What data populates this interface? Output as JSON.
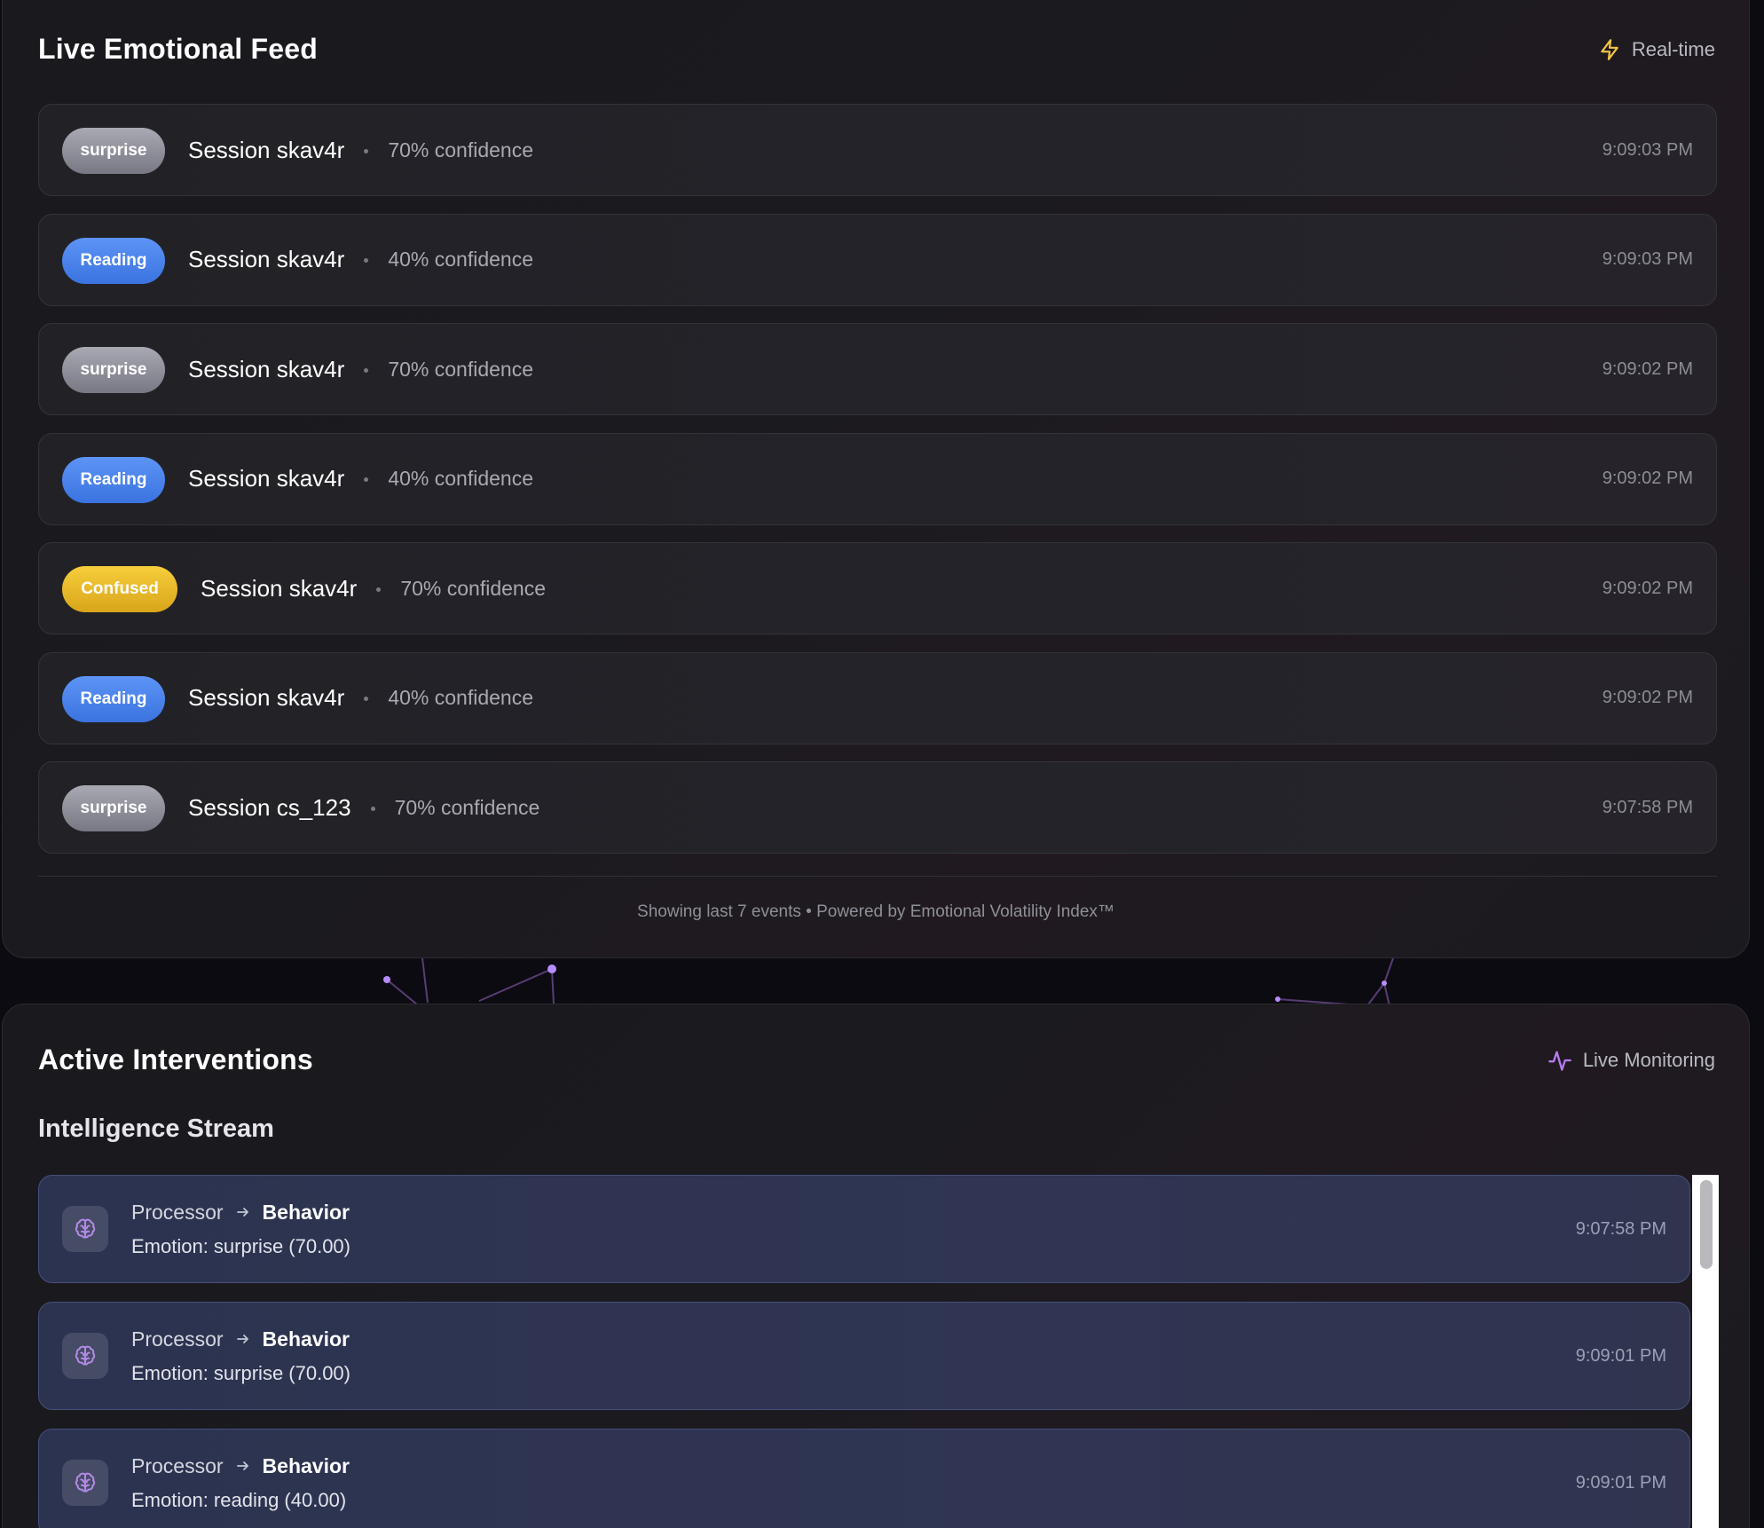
{
  "feed": {
    "title": "Live Emotional Feed",
    "badge_label": "Real-time",
    "badge_icon": "lightning-icon",
    "events": [
      {
        "emotion": "surprise",
        "variant": "surprise",
        "session": "Session skav4r",
        "confidence": "70% confidence",
        "time": "9:09:03 PM"
      },
      {
        "emotion": "Reading",
        "variant": "reading",
        "session": "Session skav4r",
        "confidence": "40% confidence",
        "time": "9:09:03 PM"
      },
      {
        "emotion": "surprise",
        "variant": "surprise",
        "session": "Session skav4r",
        "confidence": "70% confidence",
        "time": "9:09:02 PM"
      },
      {
        "emotion": "Reading",
        "variant": "reading",
        "session": "Session skav4r",
        "confidence": "40% confidence",
        "time": "9:09:02 PM"
      },
      {
        "emotion": "Confused",
        "variant": "confused",
        "session": "Session skav4r",
        "confidence": "70% confidence",
        "time": "9:09:02 PM"
      },
      {
        "emotion": "Reading",
        "variant": "reading",
        "session": "Session skav4r",
        "confidence": "40% confidence",
        "time": "9:09:02 PM"
      },
      {
        "emotion": "surprise",
        "variant": "surprise",
        "session": "Session cs_123",
        "confidence": "70% confidence",
        "time": "9:07:58 PM"
      }
    ],
    "footer": "Showing last 7 events • Powered by Emotional Volatility Index™"
  },
  "interventions": {
    "title": "Active Interventions",
    "badge_label": "Live Monitoring",
    "badge_icon": "activity-pulse-icon",
    "stream_title": "Intelligence Stream",
    "items": [
      {
        "icon": "brain-icon",
        "source": "Processor",
        "target": "Behavior",
        "description": "Emotion: surprise (70.00)",
        "time": "9:07:58 PM"
      },
      {
        "icon": "brain-icon",
        "source": "Processor",
        "target": "Behavior",
        "description": "Emotion: surprise (70.00)",
        "time": "9:09:01 PM"
      },
      {
        "icon": "brain-icon",
        "source": "Processor",
        "target": "Behavior",
        "description": "Emotion: reading (40.00)",
        "time": "9:09:01 PM"
      }
    ]
  },
  "colors": {
    "surprise": "#8f8f9a",
    "reading": "#4a83ec",
    "confused": "#ebbd2a",
    "realtime_icon": "#f5c542",
    "monitoring_icon": "#b57cf0",
    "brain_icon": "#b48ae8"
  }
}
